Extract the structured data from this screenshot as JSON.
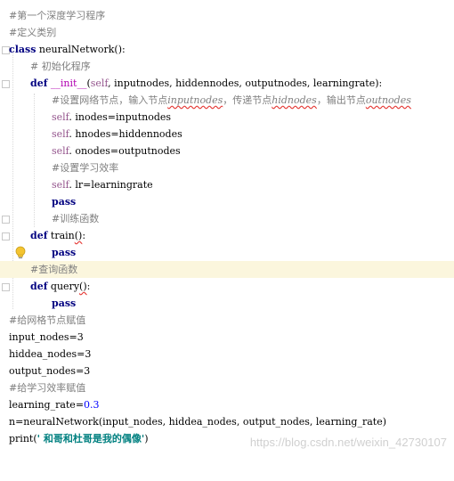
{
  "code": {
    "l1": "#第一个深度学习程序",
    "l2": "#定义类别",
    "l3_kw": "class",
    "l3_rest": " neuralNetwork():",
    "l4": "# 初始化程序",
    "l5_kw": "def",
    "l5_fn": " __init__",
    "l5_open": "(",
    "l5_self": "self",
    "l5_params": ", inputnodes, hiddennodes, outputnodes, learningrate):",
    "l6_a": "#设置网络节点，输入节点",
    "l6_b": "inputnodes",
    "l6_c": "，传递节点",
    "l6_d": "hidnodes",
    "l6_e": "，输出节点",
    "l6_f": "outnodes",
    "l7_self": "self",
    "l7_rest": ". inodes=inputnodes",
    "l8_self": "self",
    "l8_rest": ". hnodes=hiddennodes",
    "l9_self": "self",
    "l9_rest": ". onodes=outputnodes",
    "l10": "#设置学习效率",
    "l11_self": "self",
    "l11_rest": ". lr=learningrate",
    "l12": "pass",
    "l13": "#训练函数",
    "l14_kw": "def",
    "l14_fn": " train",
    "l14_sq": "()",
    "l14_end": ":",
    "l15": "pass",
    "l16": "#查询函数",
    "l17_kw": "def",
    "l17_fn": " query",
    "l17_sq": "()",
    "l17_end": ":",
    "l18": "pass",
    "l19": "#给网格节点赋值",
    "l20": "input_nodes=3",
    "l21": "hiddea_nodes=3",
    "l22": "output_nodes=3",
    "l23": "#给学习效率赋值",
    "l24_a": "learning_rate=",
    "l24_num": "0.3",
    "l25": "n=neuralNetwork(input_nodes, hiddea_nodes, output_nodes, learning_rate)",
    "l26_fn": "print(",
    "l26_str": "' 和哥和杜哥是我的偶像'",
    "l26_end": ")"
  },
  "watermark": "https://blog.csdn.net/weixin_42730107",
  "colors": {
    "keyword": "#000080",
    "comment": "#808080",
    "self": "#94558d",
    "number": "#0000ff",
    "string": "#008080",
    "caret_line": "#fbf6dd"
  },
  "icons": [
    "fold-marker-icon",
    "lightbulb-icon"
  ]
}
